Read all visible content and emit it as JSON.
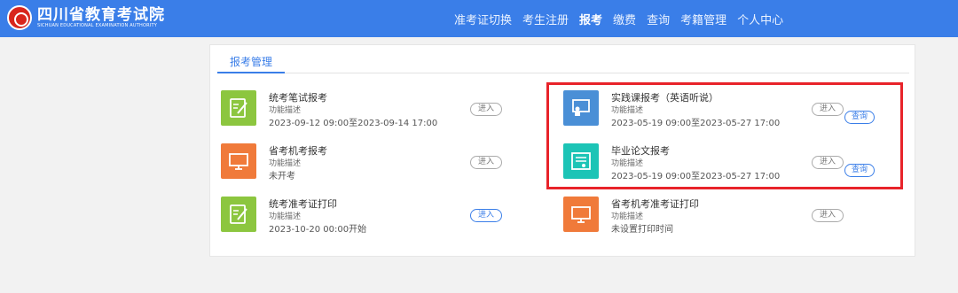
{
  "header": {
    "logo_title": "四川省教育考试院",
    "logo_subtitle": "SICHUAN EDUCATIONAL EXAMINATION AUTHORITY",
    "nav": [
      {
        "label": "准考证切换",
        "active": false
      },
      {
        "label": "考生注册",
        "active": false
      },
      {
        "label": "报考",
        "active": true
      },
      {
        "label": "缴费",
        "active": false
      },
      {
        "label": "查询",
        "active": false
      },
      {
        "label": "考籍管理",
        "active": false
      },
      {
        "label": "个人中心",
        "active": false
      }
    ]
  },
  "panel": {
    "tab_label": "报考管理",
    "items": [
      {
        "title": "统考笔试报考",
        "desc": "功能描述",
        "time": "2023-09-12 09:00至2023-09-14 17:00",
        "enter": "进入",
        "query": ""
      },
      {
        "title": "实践课报考（英语听说）",
        "desc": "功能描述",
        "time": "2023-05-19 09:00至2023-05-27 17:00",
        "enter": "进入",
        "query": "查询"
      },
      {
        "title": "省考机考报考",
        "desc": "功能描述",
        "time": "未开考",
        "enter": "进入",
        "query": ""
      },
      {
        "title": "毕业论文报考",
        "desc": "功能描述",
        "time": "2023-05-19 09:00至2023-05-27 17:00",
        "enter": "进入",
        "query": "查询"
      },
      {
        "title": "统考准考证打印",
        "desc": "功能描述",
        "time": "2023-10-20 00:00开始",
        "enter": "进入",
        "query": ""
      },
      {
        "title": "省考机考准考证打印",
        "desc": "功能描述",
        "time": "未设置打印时间",
        "enter": "进入",
        "query": ""
      }
    ]
  },
  "colors": {
    "topbar": "#3a7ee8",
    "icon_green": "#8cc63f",
    "icon_orange": "#f07a3a",
    "icon_blue": "#4a8fd6",
    "icon_teal": "#1cc4b6",
    "highlight": "#e8232a"
  },
  "icons": [
    "pen-notebook-icon",
    "classroom-board-icon",
    "monitor-exam-icon",
    "certificate-icon",
    "pen-notebook-icon",
    "monitor-exam-icon"
  ]
}
